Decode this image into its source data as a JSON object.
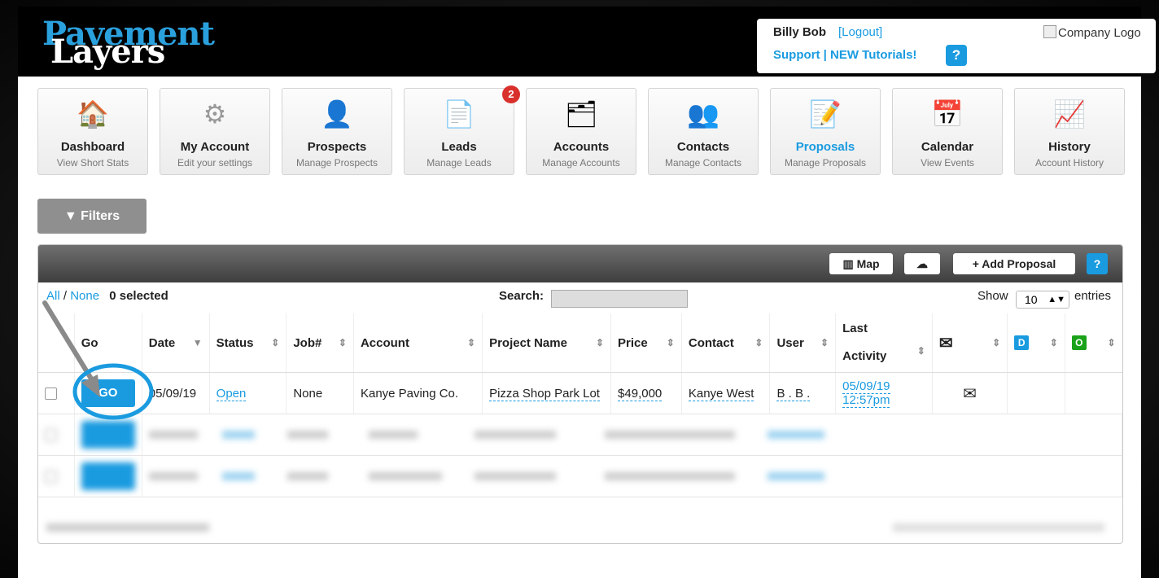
{
  "brand": {
    "line1": "Pavement",
    "line2": "Layers"
  },
  "user": {
    "name": "Billy Bob",
    "logout": "[Logout]",
    "support": "Support  |  NEW Tutorials!",
    "help": "?",
    "company_logo": "Company Logo"
  },
  "nav": [
    {
      "title": "Dashboard",
      "sub": "View Short Stats",
      "icon": "house-icon",
      "glyph": "🏠"
    },
    {
      "title": "My Account",
      "sub": "Edit your settings",
      "icon": "gear-icon",
      "glyph": "⚙"
    },
    {
      "title": "Prospects",
      "sub": "Manage Prospects",
      "icon": "hooded-person-icon",
      "glyph": "👤"
    },
    {
      "title": "Leads",
      "sub": "Manage Leads",
      "icon": "papers-icon",
      "glyph": "📄",
      "badge": "2"
    },
    {
      "title": "Accounts",
      "sub": "Manage Accounts",
      "icon": "file-stack-icon",
      "glyph": "🗂"
    },
    {
      "title": "Contacts",
      "sub": "Manage Contacts",
      "icon": "people-icon",
      "glyph": "👥"
    },
    {
      "title": "Proposals",
      "sub": "Manage Proposals",
      "icon": "document-pen-icon",
      "glyph": "📝"
    },
    {
      "title": "Calendar",
      "sub": "View Events",
      "icon": "calendar-icon",
      "glyph": "📅"
    },
    {
      "title": "History",
      "sub": "Account History",
      "icon": "monitor-graph-icon",
      "glyph": "📈"
    }
  ],
  "filters": {
    "label": "Filters"
  },
  "toolbar": {
    "map": "Map",
    "add": "+ Add Proposal",
    "help": "?"
  },
  "controls": {
    "all": "All",
    "none": "None",
    "selected": "0 selected",
    "search_label": "Search:",
    "show": "Show",
    "entries_value": "10",
    "entries": "entries"
  },
  "columns": {
    "go": "Go",
    "date": "Date",
    "status": "Status",
    "job": "Job#",
    "account": "Account",
    "project": "Project Name",
    "price": "Price",
    "contact": "Contact",
    "user": "User",
    "last_activity": "Last Activity",
    "d": "D",
    "o": "O"
  },
  "colors": {
    "accent": "#1a9be0",
    "badge": "#d9302c",
    "d_badge": "#1a9be0",
    "o_badge": "#1aa21a"
  },
  "rows": [
    {
      "go": "GO",
      "date": "05/09/19",
      "status": "Open",
      "job": "None",
      "account": "Kanye Paving Co.",
      "project": "Pizza Shop Park Lot",
      "price": "$49,000",
      "contact": "Kanye West",
      "user": "B . B .",
      "last_activity": "05/09/19 12:57pm"
    }
  ]
}
